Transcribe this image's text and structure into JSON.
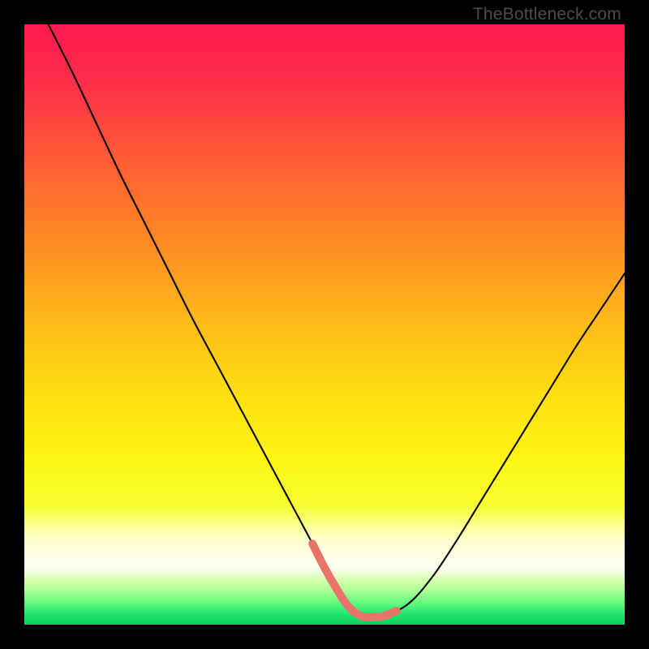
{
  "watermark": "TheBottleneck.com",
  "chart_data": {
    "type": "line",
    "title": "",
    "xlabel": "",
    "ylabel": "",
    "xlim": [
      0,
      100
    ],
    "ylim": [
      0,
      100
    ],
    "series": [
      {
        "name": "bottleneck-curve",
        "x": [
          4,
          8,
          12,
          16,
          20,
          24,
          28,
          32,
          36,
          40,
          44,
          48,
          50,
          52,
          54,
          56,
          58,
          60,
          64,
          68,
          72,
          76,
          80,
          84,
          88,
          92,
          96,
          100
        ],
        "y": [
          100,
          92,
          83.5,
          75,
          67,
          59,
          51,
          43.5,
          36,
          28.5,
          21,
          13.5,
          9.5,
          6,
          3,
          1.5,
          1.2,
          1.5,
          3.5,
          8,
          14,
          20.5,
          27,
          33.5,
          40,
          46.5,
          52.5,
          58.5
        ]
      }
    ],
    "highlight": {
      "name": "valley-highlight",
      "color": "#e9746c",
      "x": [
        48,
        50,
        52,
        54,
        56,
        58,
        60,
        62
      ],
      "y": [
        13.5,
        9.5,
        6,
        3,
        1.5,
        1.2,
        1.5,
        2.3
      ]
    },
    "gradient_stops": [
      {
        "pos": 0.0,
        "color": "#ff1a4f"
      },
      {
        "pos": 0.1,
        "color": "#ff2f49"
      },
      {
        "pos": 0.22,
        "color": "#ff5a36"
      },
      {
        "pos": 0.36,
        "color": "#ff8a24"
      },
      {
        "pos": 0.5,
        "color": "#ffbb18"
      },
      {
        "pos": 0.62,
        "color": "#ffe012"
      },
      {
        "pos": 0.72,
        "color": "#fff414"
      },
      {
        "pos": 0.8,
        "color": "#f7ff2f"
      },
      {
        "pos": 0.86,
        "color": "#ffffd2"
      },
      {
        "pos": 0.905,
        "color": "#fffff2"
      },
      {
        "pos": 0.925,
        "color": "#d8ffb0"
      },
      {
        "pos": 0.945,
        "color": "#a8ff92"
      },
      {
        "pos": 0.965,
        "color": "#5cf97d"
      },
      {
        "pos": 0.985,
        "color": "#18e46a"
      },
      {
        "pos": 1.0,
        "color": "#0ccf5e"
      }
    ]
  }
}
